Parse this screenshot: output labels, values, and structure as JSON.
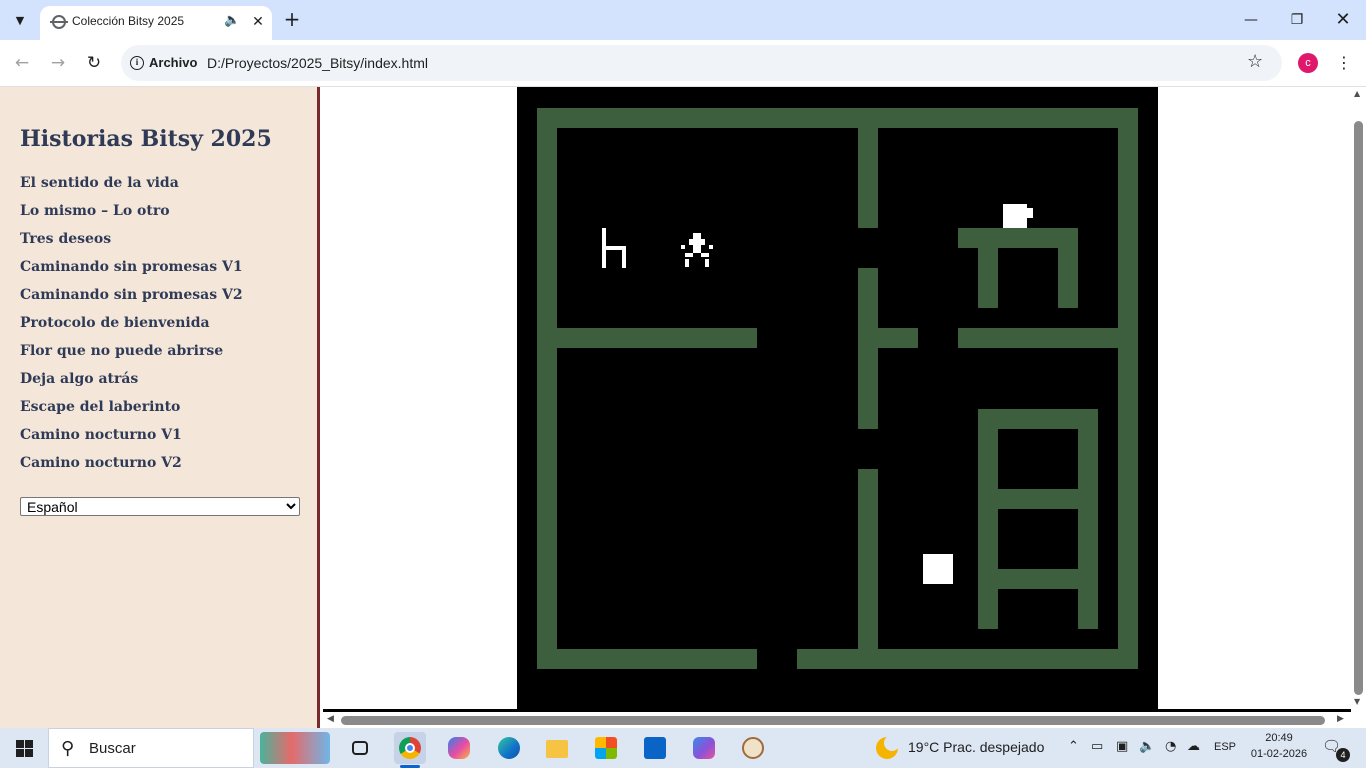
{
  "browser": {
    "tab": {
      "title": "Colección Bitsy 2025"
    },
    "address": {
      "chip_label": "Archivo",
      "url": "D:/Proyectos/2025_Bitsy/index.html"
    },
    "profile_initial": "c"
  },
  "sidebar": {
    "title": "Historias Bitsy 2025",
    "stories": [
      "El sentido de la vida",
      "Lo mismo – Lo otro",
      "Tres deseos",
      "Caminando sin promesas V1",
      "Caminando sin promesas V2",
      "Protocolo de bienvenida",
      "Flor que no puede abrirse",
      "Deja algo atrás",
      "Escape del laberinto",
      "Camino nocturno V1",
      "Camino nocturno V2"
    ],
    "language": {
      "selected": "Español"
    }
  },
  "game": {
    "colors": {
      "background": "#000000",
      "wall": "#3d5f3d",
      "sprite": "#ffffff"
    }
  },
  "taskbar": {
    "search_text": "Buscar",
    "weather": {
      "temp": "19°C",
      "condition": "Prac. despejado"
    },
    "language": "ESP",
    "time": "20:49",
    "date": "01-02-2026",
    "notifications": "4"
  }
}
